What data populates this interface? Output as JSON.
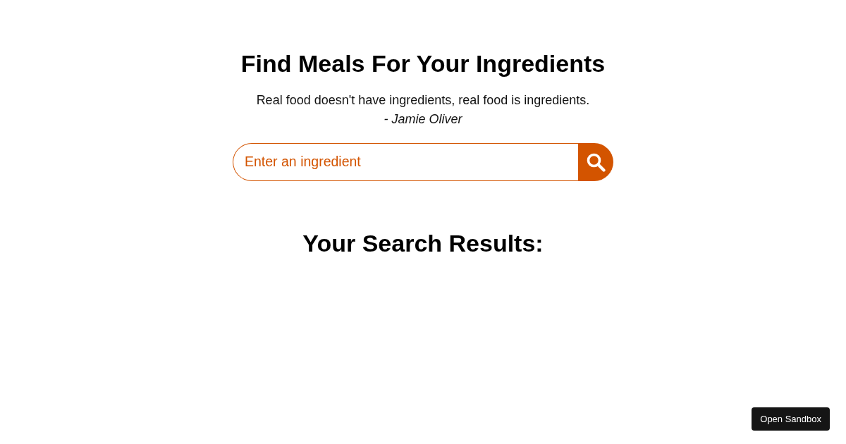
{
  "heading": "Find Meals For Your Ingredients",
  "quote": {
    "text": "Real food doesn't have ingredients, real food is ingredients.",
    "author": "- Jamie Oliver"
  },
  "search": {
    "placeholder": "Enter an ingredient"
  },
  "results_heading": "Your Search Results:",
  "sandbox_button": "Open Sandbox"
}
